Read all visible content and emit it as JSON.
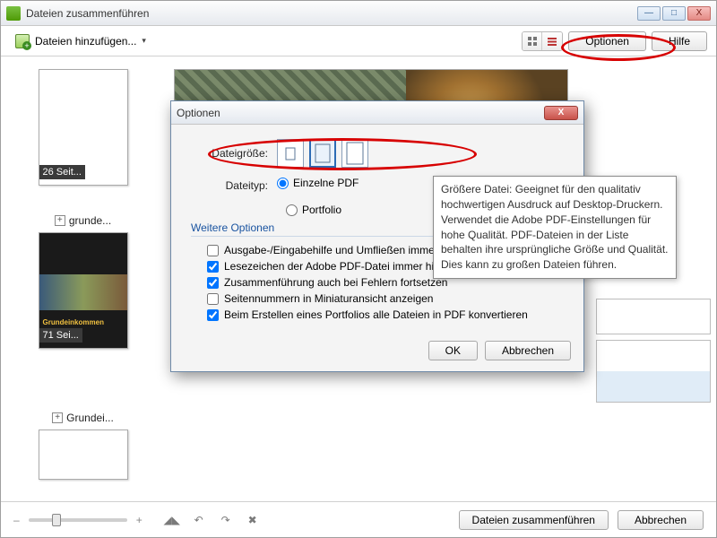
{
  "window": {
    "title": "Dateien zusammenführen",
    "minimize": "—",
    "maximize": "□",
    "close": "X"
  },
  "toolbar": {
    "add_files_label": "Dateien hinzufügen...",
    "dropdown_glyph": "▾",
    "options_label": "Optionen",
    "help_label": "Hilfe"
  },
  "thumbnails": [
    {
      "badge": "26 Seit...",
      "caption": ""
    },
    {
      "badge": "71 Sei...",
      "caption": "grunde...",
      "title_inside": "Grundeinkommen"
    },
    {
      "caption": "Grundei..."
    }
  ],
  "wide_thumb": {
    "magnify_glyph": "⊕"
  },
  "footer": {
    "merge_label": "Dateien zusammenführen",
    "cancel_label": "Abbrechen"
  },
  "dialog": {
    "title": "Optionen",
    "close_glyph": "X",
    "filesize_label": "Dateigröße:",
    "filetype_label": "Dateityp:",
    "filetype_options": {
      "single": "Einzelne PDF",
      "portfolio": "Portfolio"
    },
    "more_options_label": "Weitere Optionen",
    "checkboxes": [
      {
        "label": "Ausgabe-/Eingabehilfe und Umfließen immer aktivieren",
        "checked": false
      },
      {
        "label": "Lesezeichen der Adobe PDF-Datei immer hinzufügen",
        "checked": true
      },
      {
        "label": "Zusammenführung auch bei Fehlern fortsetzen",
        "checked": true
      },
      {
        "label": "Seitennummern in Miniaturansicht anzeigen",
        "checked": false
      },
      {
        "label": "Beim Erstellen eines Portfolios alle Dateien in PDF konvertieren",
        "checked": true
      }
    ],
    "ok_label": "OK",
    "cancel_label": "Abbrechen"
  },
  "tooltip": {
    "text": "Größere Datei: Geeignet für den qualitativ hochwertigen Ausdruck auf Desktop-Druckern. Verwendet die Adobe PDF-Einstellungen für hohe Qualität. PDF-Dateien in der Liste behalten ihre ursprüngliche Größe und Qualität. Dies kann zu großen Dateien führen."
  }
}
